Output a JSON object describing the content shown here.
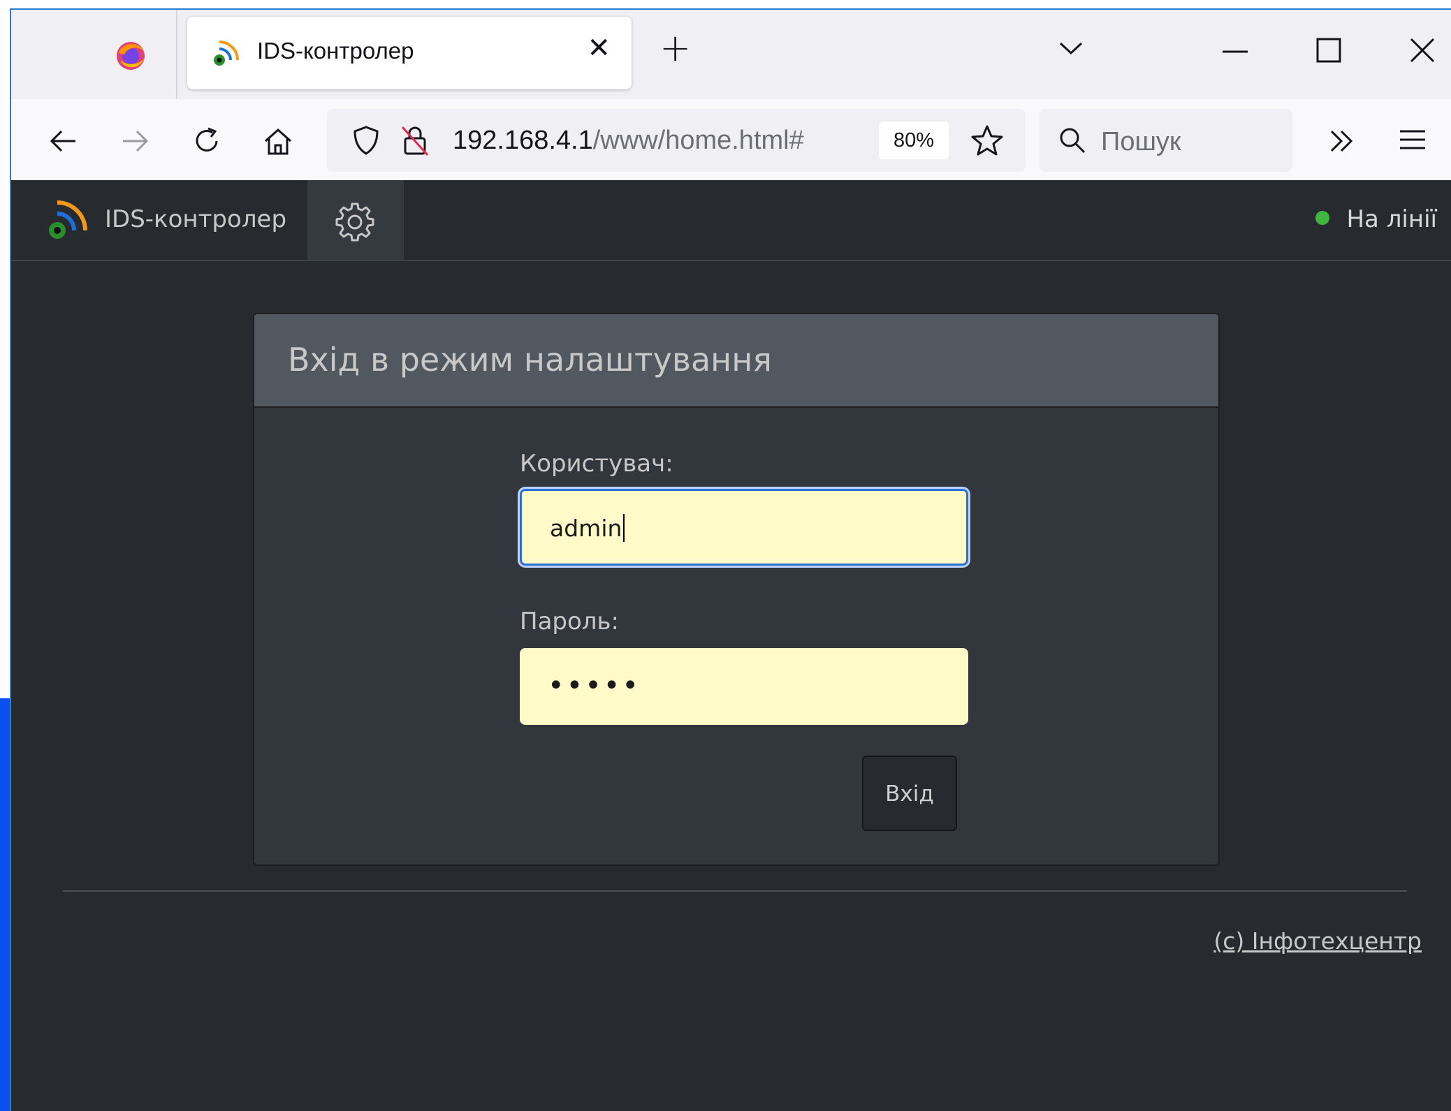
{
  "browser": {
    "tab": {
      "title": "IDS-контролер",
      "close_glyph": "✕",
      "favicon": "wifi-signal-icon"
    },
    "new_tab_glyph": "+",
    "address": {
      "host": "192.168.4.1",
      "path": "/www/home.html#",
      "zoom": "80%"
    },
    "search": {
      "placeholder": "Пошук"
    }
  },
  "app": {
    "brand": "IDS-контролер",
    "status": "На лінії",
    "status_color": "#3fb63f"
  },
  "login": {
    "title": "Вхід в режим налаштування",
    "user_label": "Користувач:",
    "user_value": "admin",
    "password_label": "Пароль:",
    "password_mask": "•••••",
    "submit_label": "Вхід"
  },
  "footer": {
    "copyright": "(c) Інфотехцентр"
  },
  "colors": {
    "page_bg": "#272b30",
    "card_bg": "#32373d",
    "card_header_bg": "#525860",
    "input_bg": "#fffac8",
    "focus_border": "#2e6fd6"
  }
}
